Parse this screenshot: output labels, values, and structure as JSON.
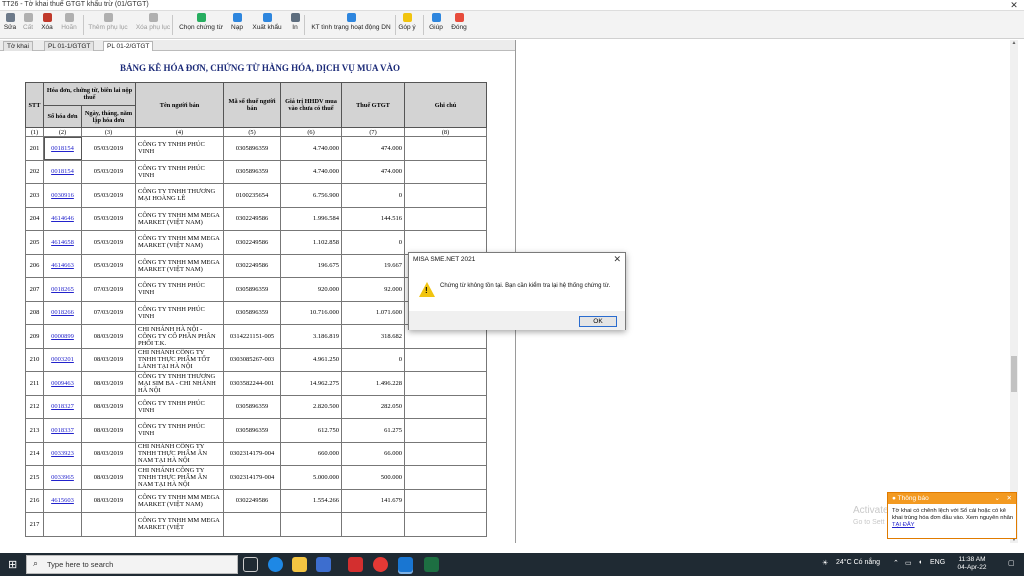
{
  "window": {
    "title": "TT26 - Tờ khai thuế GTGT khấu trừ (01/GTGT)"
  },
  "toolbar": {
    "buttons": [
      {
        "label": "Sửa",
        "color": "#6d7a8a",
        "disabled": false
      },
      {
        "label": "Cất",
        "color": "#b0b0b0",
        "disabled": true
      },
      {
        "label": "Xóa",
        "color": "#c0392b",
        "disabled": false
      },
      {
        "label": "Hoãn",
        "color": "#b0b0b0",
        "disabled": true
      },
      {
        "label": "Thêm phụ lục",
        "color": "#b0b0b0",
        "disabled": true
      },
      {
        "label": "Xóa phụ lục",
        "color": "#b0b0b0",
        "disabled": true
      },
      {
        "label": "Chọn chứng từ",
        "color": "#27ae60",
        "disabled": false
      },
      {
        "label": "Nạp",
        "color": "#2e86de",
        "disabled": false
      },
      {
        "label": "Xuất khẩu",
        "color": "#2e86de",
        "disabled": false
      },
      {
        "label": "In",
        "color": "#5d6d7e",
        "disabled": false
      },
      {
        "label": "KT tình trạng hoạt động DN",
        "color": "#2e86de",
        "disabled": false
      },
      {
        "label": "Góp ý",
        "color": "#f1c40f",
        "disabled": false
      },
      {
        "label": "Giúp",
        "color": "#2e86de",
        "disabled": false
      },
      {
        "label": "Đóng",
        "color": "#e74c3c",
        "disabled": false
      }
    ]
  },
  "tabs": [
    {
      "label": "Tờ khai",
      "active": false
    },
    {
      "label": "PL 01-1/GTGT",
      "active": false
    },
    {
      "label": "PL 01-2/GTGT",
      "active": true
    }
  ],
  "report": {
    "title": "BẢNG KÊ HÓA ĐƠN, CHỨNG TỪ HÀNG HÓA, DỊCH VỤ MUA VÀO",
    "headers": {
      "stt": "STT",
      "group": "Hóa đơn, chứng từ, biên lai nộp thuế",
      "invoice_no": "Số hóa đơn",
      "date": "Ngày, tháng, năm lập hóa đơn",
      "seller": "Tên người bán",
      "tax_code": "Mã số thuế người bán",
      "value": "Giá trị HHDV mua vào chưa có thuế",
      "vat": "Thuế GTGT",
      "note": "Ghi chú"
    },
    "col_numbers": [
      "(1)",
      "(2)",
      "(3)",
      "(4)",
      "(5)",
      "(6)",
      "(7)",
      "(8)"
    ],
    "rows": [
      {
        "stt": "201",
        "inv": "0018154",
        "date": "05/03/2019",
        "seller": "CÔNG TY TNHH PHÚC VINH",
        "mst": "0305896359",
        "value": "4.740.000",
        "vat": "474.000",
        "note": ""
      },
      {
        "stt": "202",
        "inv": "0018154",
        "date": "05/03/2019",
        "seller": "CÔNG TY TNHH PHÚC VINH",
        "mst": "0305896359",
        "value": "4.740.000",
        "vat": "474.000",
        "note": ""
      },
      {
        "stt": "203",
        "inv": "0030916",
        "date": "05/03/2019",
        "seller": "CÔNG TY TNHH THƯƠNG MẠI HOÀNG LÊ",
        "mst": "0100235654",
        "value": "6.756.900",
        "vat": "0",
        "note": ""
      },
      {
        "stt": "204",
        "inv": "4614646",
        "date": "05/03/2019",
        "seller": "CÔNG TY TNHH MM MEGA MARKET (VIỆT NAM)",
        "mst": "0302249586",
        "value": "1.996.584",
        "vat": "144.516",
        "note": ""
      },
      {
        "stt": "205",
        "inv": "4614658",
        "date": "05/03/2019",
        "seller": "CÔNG TY TNHH MM MEGA MARKET (VIỆT NAM)",
        "mst": "0302249586",
        "value": "1.102.858",
        "vat": "0",
        "note": ""
      },
      {
        "stt": "206",
        "inv": "4614663",
        "date": "05/03/2019",
        "seller": "CÔNG TY TNHH MM MEGA MARKET (VIỆT NAM)",
        "mst": "0302249586",
        "value": "196.675",
        "vat": "19.667",
        "note": ""
      },
      {
        "stt": "207",
        "inv": "0018265",
        "date": "07/03/2019",
        "seller": "CÔNG TY TNHH PHÚC VINH",
        "mst": "0305896359",
        "value": "920.000",
        "vat": "92.000",
        "note": ""
      },
      {
        "stt": "208",
        "inv": "0018266",
        "date": "07/03/2019",
        "seller": "CÔNG TY TNHH PHÚC VINH",
        "mst": "0305896359",
        "value": "10.716.000",
        "vat": "1.071.600",
        "note": ""
      },
      {
        "stt": "209",
        "inv": "0000899",
        "date": "08/03/2019",
        "seller": "CHI NHÁNH HÀ NỘI - CÔNG TY CỔ PHẦN PHÂN PHỐI T.K.",
        "mst": "0314221151-005",
        "value": "3.186.819",
        "vat": "318.682",
        "note": ""
      },
      {
        "stt": "210",
        "inv": "0003201",
        "date": "08/03/2019",
        "seller": "CHI NHÁNH CÔNG TY TNHH THỰC PHẨM TỐT LÀNH TẠI HÀ NỘI",
        "mst": "0303085267-003",
        "value": "4.961.250",
        "vat": "0",
        "note": ""
      },
      {
        "stt": "211",
        "inv": "0009463",
        "date": "08/03/2019",
        "seller": "CÔNG TY TNHH THƯƠNG MẠI SIM BA - CHI NHÁNH HÀ NỘI",
        "mst": "0303582244-001",
        "value": "14.962.275",
        "vat": "1.496.228",
        "note": ""
      },
      {
        "stt": "212",
        "inv": "0018327",
        "date": "08/03/2019",
        "seller": "CÔNG TY TNHH PHÚC VINH",
        "mst": "0305896359",
        "value": "2.820.500",
        "vat": "282.050",
        "note": ""
      },
      {
        "stt": "213",
        "inv": "0018337",
        "date": "08/03/2019",
        "seller": "CÔNG TY TNHH PHÚC VINH",
        "mst": "0305896359",
        "value": "612.750",
        "vat": "61.275",
        "note": ""
      },
      {
        "stt": "214",
        "inv": "0033923",
        "date": "08/03/2019",
        "seller": "CHI NHÁNH CÔNG TY TNHH THỰC PHẨM ÂN NAM TẠI HÀ NỘI",
        "mst": "0302314179-004",
        "value": "660.000",
        "vat": "66.000",
        "note": ""
      },
      {
        "stt": "215",
        "inv": "0033965",
        "date": "08/03/2019",
        "seller": "CHI NHÁNH CÔNG TY TNHH THỰC PHẨM ÂN NAM TẠI HÀ NỘI",
        "mst": "0302314179-004",
        "value": "5.000.000",
        "vat": "500.000",
        "note": ""
      },
      {
        "stt": "216",
        "inv": "4615603",
        "date": "08/03/2019",
        "seller": "CÔNG TY TNHH MM MEGA MARKET (VIỆT NAM)",
        "mst": "0302249586",
        "value": "1.554.266",
        "vat": "141.679",
        "note": ""
      },
      {
        "stt": "217",
        "inv": "",
        "date": "",
        "seller": "CÔNG TY TNHH MM MEGA MARKET (VIỆT",
        "mst": "",
        "value": "",
        "vat": "",
        "note": ""
      }
    ]
  },
  "dialog": {
    "title": "MISA SME.NET 2021",
    "message": "Chứng từ không tồn tại. Bạn cần kiểm tra lại hệ thống chứng từ.",
    "ok_label": "OK"
  },
  "watermark": {
    "line1": "Activate W",
    "line2": "Go to Sett"
  },
  "notification": {
    "title": "Thông báo",
    "body": "Tờ khai có chênh lệch với Sổ cái hoặc có kê khai trùng hóa đơn đầu vào. Xem nguyên nhân",
    "link": "TẠI ĐÂY"
  },
  "taskbar": {
    "search_placeholder": "Type here to search",
    "weather": "24°C Có nắng",
    "language": "ENG",
    "time": "11:38 AM",
    "date": "04-Apr-22"
  }
}
